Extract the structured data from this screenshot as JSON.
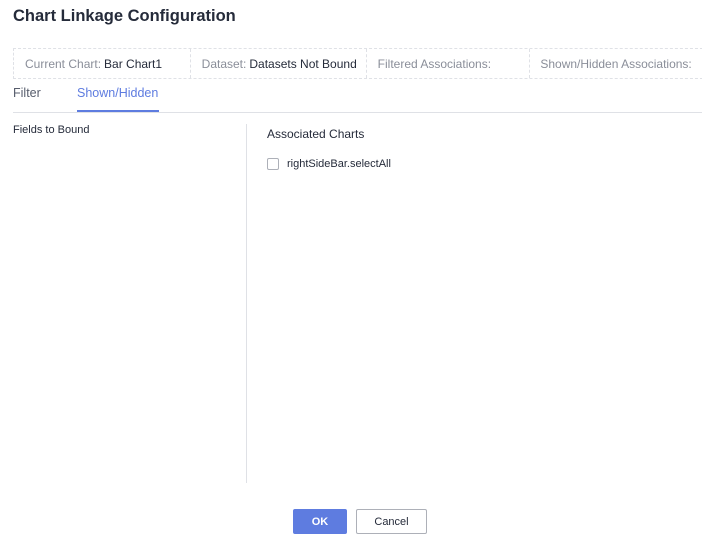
{
  "dialog": {
    "title": "Chart Linkage Configuration"
  },
  "info_bar": {
    "current_chart_label": "Current Chart:",
    "current_chart_value": "Bar Chart1",
    "dataset_label": "Dataset:",
    "dataset_value": "Datasets Not Bound",
    "filtered_label": "Filtered Associations:",
    "shown_hidden_label": "Shown/Hidden Associations:"
  },
  "tabs": [
    {
      "label": "Filter",
      "active": false
    },
    {
      "label": "Shown/Hidden",
      "active": true
    }
  ],
  "left_pane": {
    "title": "Fields to Bound"
  },
  "right_pane": {
    "title": "Associated Charts",
    "items": [
      {
        "label": "rightSideBar.selectAll",
        "checked": false
      }
    ]
  },
  "footer": {
    "ok_label": "OK",
    "cancel_label": "Cancel"
  },
  "colors": {
    "accent": "#5e7ce0",
    "text": "#252b3a",
    "muted": "#8a8e99",
    "border": "#dfe1e6"
  }
}
